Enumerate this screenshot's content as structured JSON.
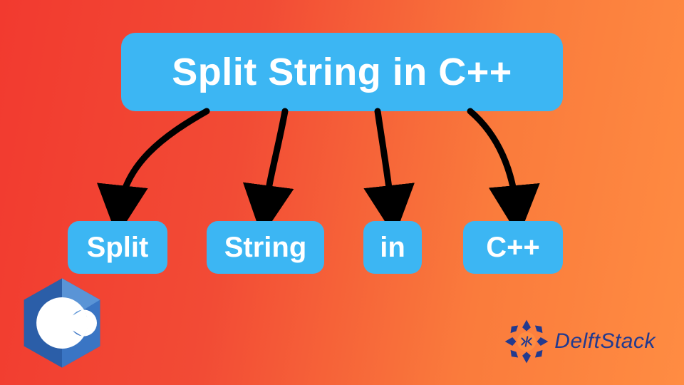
{
  "main": {
    "label": "Split String in C++"
  },
  "children": [
    {
      "label": "Split"
    },
    {
      "label": "String"
    },
    {
      "label": "in"
    },
    {
      "label": "C++"
    }
  ],
  "logos": {
    "cpp": "C++",
    "brand": "DelftStack"
  },
  "colors": {
    "box": "#3cb6f3",
    "text": "#ffffff",
    "arrow": "#000000",
    "brand": "#223a8f"
  }
}
